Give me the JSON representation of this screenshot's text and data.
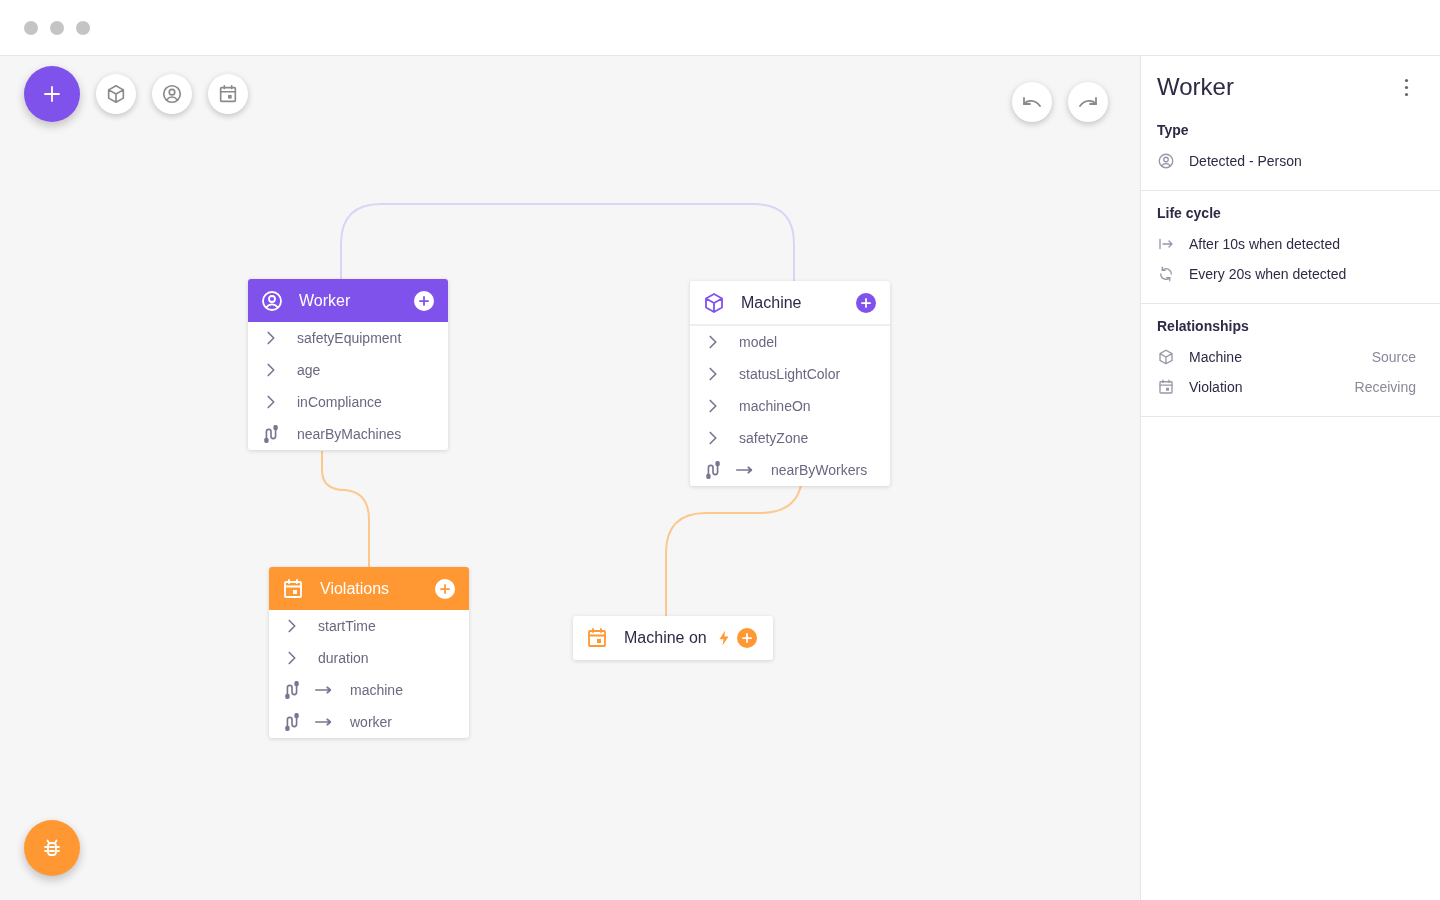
{
  "toolbar": {
    "tools": [
      {
        "kind": "object"
      },
      {
        "kind": "person"
      },
      {
        "kind": "event"
      }
    ]
  },
  "history": [
    {
      "kind": "undo"
    },
    {
      "kind": "redo"
    }
  ],
  "nodes": [
    {
      "title": "Worker",
      "kind": "person",
      "color": "#8052ec",
      "fields": [
        {
          "kind": "attribute",
          "label": "safetyEquipment"
        },
        {
          "kind": "attribute",
          "label": "age"
        },
        {
          "kind": "attribute",
          "label": "inCompliance"
        },
        {
          "kind": "relation",
          "label": "nearByMachines",
          "arrow": false
        }
      ]
    },
    {
      "title": "Machine",
      "kind": "object",
      "color": "#8052ec",
      "fields": [
        {
          "kind": "attribute",
          "label": "model"
        },
        {
          "kind": "attribute",
          "label": "statusLightColor"
        },
        {
          "kind": "attribute",
          "label": "machineOn"
        },
        {
          "kind": "attribute",
          "label": "safetyZone"
        },
        {
          "kind": "relation",
          "label": "nearByWorkers",
          "arrow": true
        }
      ]
    },
    {
      "title": "Violations",
      "kind": "event",
      "color": "#ff9833",
      "fields": [
        {
          "kind": "attribute",
          "label": "startTime"
        },
        {
          "kind": "attribute",
          "label": "duration"
        },
        {
          "kind": "relation",
          "label": "machine",
          "arrow": true
        },
        {
          "kind": "relation",
          "label": "worker",
          "arrow": true
        }
      ]
    },
    {
      "title": "Machine on",
      "kind": "trigger",
      "color": "#ff9833"
    }
  ],
  "panel": {
    "title": "Worker",
    "sections": [
      {
        "heading": "Type",
        "items": [
          {
            "kind": "person",
            "text": "Detected - Person"
          }
        ]
      },
      {
        "heading": "Life cycle",
        "items": [
          {
            "kind": "delay",
            "text": "After 10s when detected"
          },
          {
            "kind": "repeat",
            "text": "Every 20s when detected"
          }
        ]
      },
      {
        "heading": "Relationships",
        "items": [
          {
            "kind": "object",
            "text": "Machine",
            "role": "Source"
          },
          {
            "kind": "event",
            "text": "Violation",
            "role": "Receiving"
          }
        ]
      }
    ]
  }
}
